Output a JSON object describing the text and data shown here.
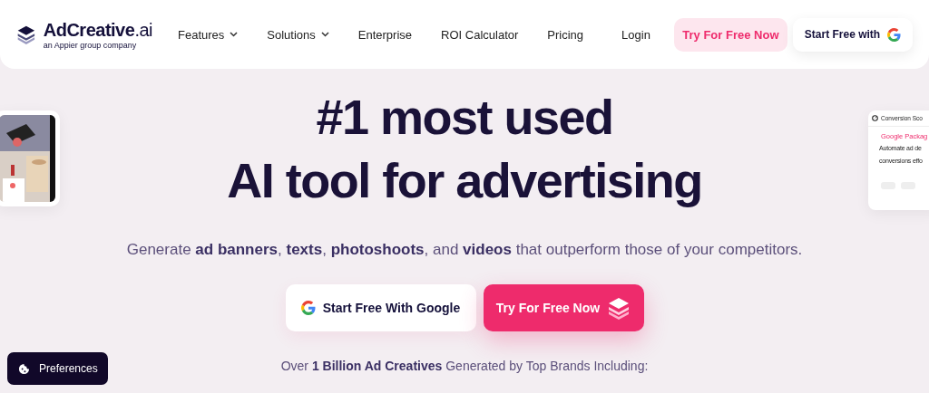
{
  "header": {
    "logo": {
      "name": "**AdCreative**.ai",
      "tagline": "an Appier group company"
    },
    "nav": [
      {
        "label": "Features",
        "dropdown": true
      },
      {
        "label": "Solutions",
        "dropdown": true
      },
      {
        "label": "Enterprise",
        "dropdown": false
      },
      {
        "label": "ROI Calculator",
        "dropdown": false
      },
      {
        "label": "Pricing",
        "dropdown": false
      }
    ],
    "login": "Login",
    "cta": "Try For Free Now",
    "google_cta": "Start Free with"
  },
  "side_card_right": {
    "title": "Conversion Sco",
    "link": "Google Packag",
    "lines": [
      "Automate ad de",
      "conversions effo"
    ]
  },
  "hero": {
    "headline": [
      "#1 most used",
      "AI tool for advertising"
    ],
    "subtitle": "Generate **ad banners**, **texts**, **photoshoots**, and **videos** that outperform those of your competitors.",
    "google_button": "Start Free With Google",
    "try_button": "Try For Free Now",
    "proof": "Over **1 Billion Ad Creatives** Generated by Top Brands Including:"
  },
  "preferences_button": "Preferences"
}
